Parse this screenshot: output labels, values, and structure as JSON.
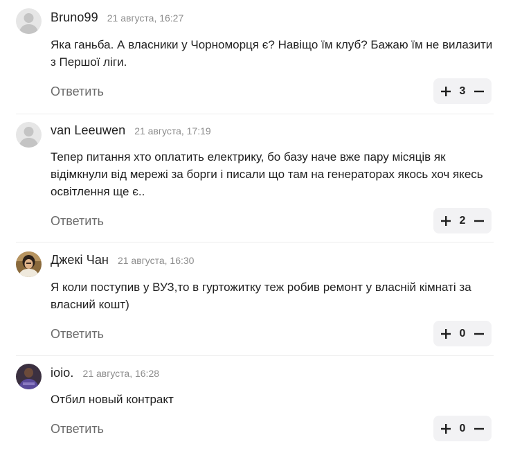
{
  "ui": {
    "reply_label": "Ответить",
    "plus_icon": "plus-icon",
    "minus_icon": "minus-icon"
  },
  "comments": [
    {
      "author": "Bruno99",
      "date": "21 августа, 16:27",
      "text": "Яка ганьба. А власники у Чорноморця є? Навіщо їм клуб? Бажаю їм не вилазити з Першої ліги.",
      "votes": "3",
      "avatar": "placeholder"
    },
    {
      "author": "van Leeuwen",
      "date": "21 августа, 17:19",
      "text": "Тепер питання хто оплатить електрику, бо базу наче вже пару місяців як відімкнули від мережі за борги і писали що там на генераторах якось хоч якесь освітлення ще є..",
      "votes": "2",
      "avatar": "placeholder"
    },
    {
      "author": "Джекі Чан",
      "date": "21 августа, 16:30",
      "text": "Я коли поступив у ВУЗ,то в гуртожитку теж робив ремонт у власній кімнаті за власний кошт)",
      "votes": "0",
      "avatar": "photo"
    },
    {
      "author": "ioio.",
      "date": "21 августа, 16:28",
      "text": "Отбил новый контракт",
      "votes": "0",
      "avatar": "photo"
    }
  ]
}
